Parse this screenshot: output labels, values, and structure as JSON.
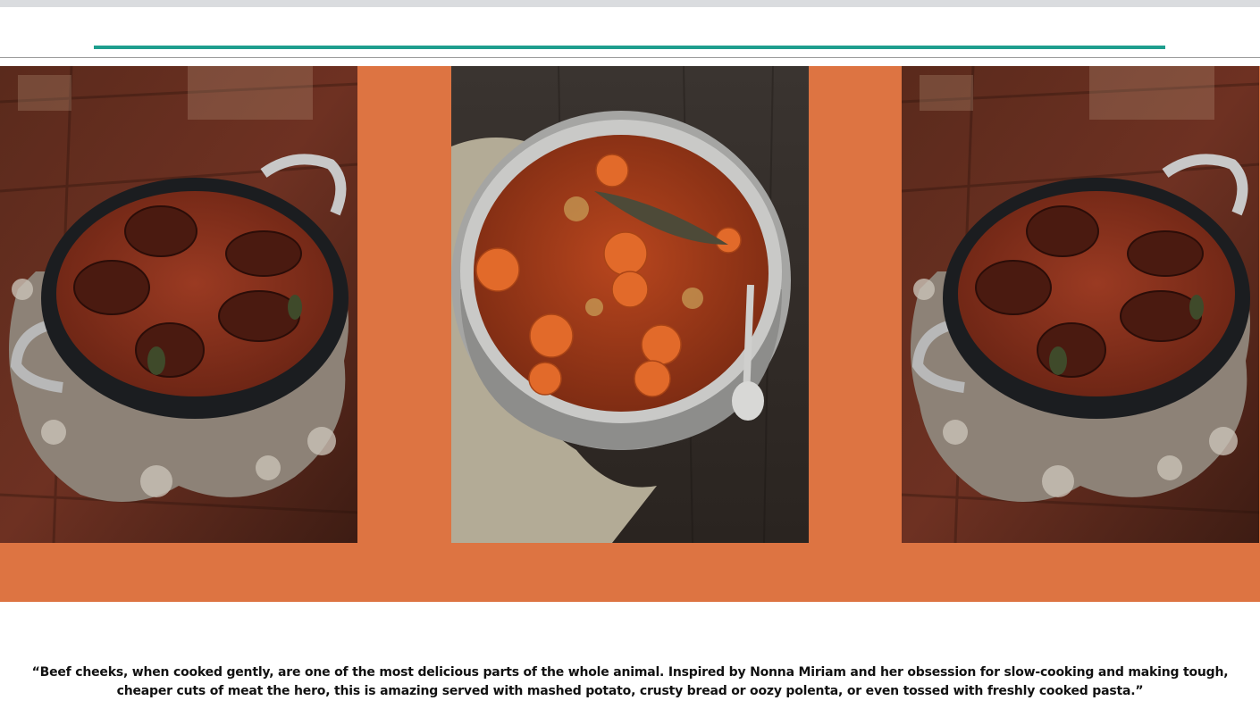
{
  "colors": {
    "accent_teal": "#1e9e8e",
    "band_orange": "#dd7442",
    "top_bar": "#dadcdf"
  },
  "gallery": {
    "images": [
      {
        "subject": "braised beef cheeks in black pan on carved wooden trivet"
      },
      {
        "subject": "beef stew with carrots and bay leaf in silver pot with spoon"
      },
      {
        "subject": "braised beef cheeks in black pan on carved wooden trivet"
      }
    ]
  },
  "quote": {
    "text": "“Beef cheeks, when cooked gently, are one of the most delicious parts of the whole animal. Inspired by Nonna Miriam and her obsession for slow-cooking and making tough, cheaper cuts of meat the hero, this is amazing served with mashed potato, crusty bread or oozy polenta, or even tossed with freshly cooked pasta.”"
  }
}
